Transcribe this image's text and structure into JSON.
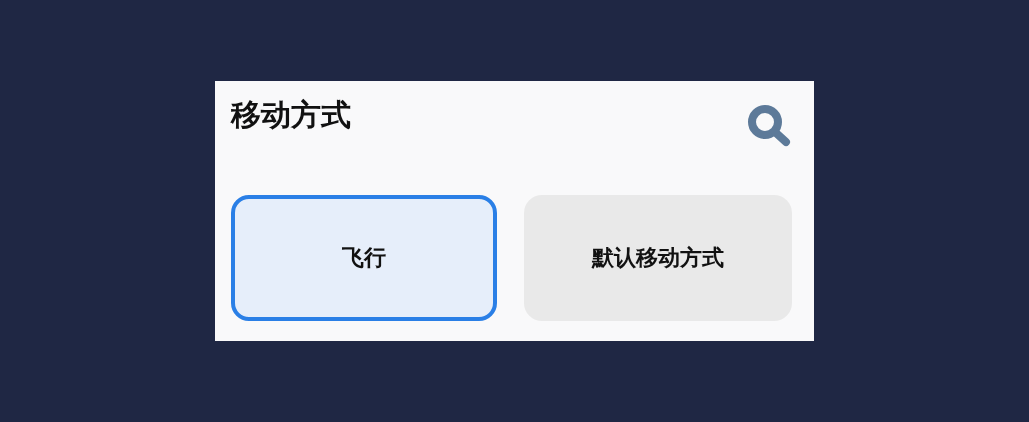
{
  "panel": {
    "title": "移动方式"
  },
  "options": [
    {
      "label": "飞行",
      "selected": true
    },
    {
      "label": "默认移动方式",
      "selected": false
    }
  ]
}
